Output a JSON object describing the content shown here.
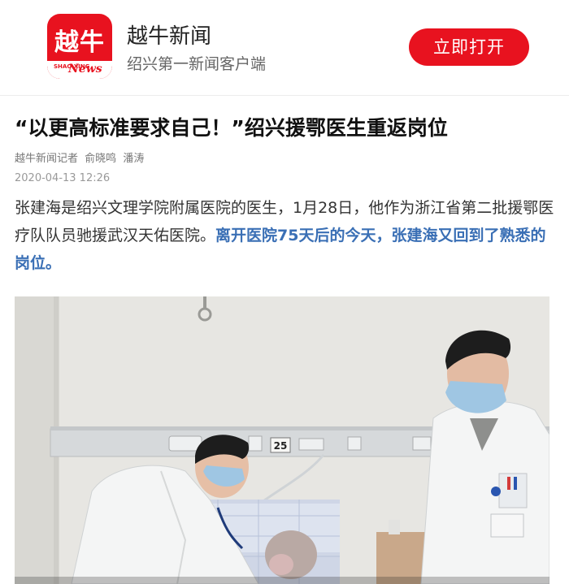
{
  "header": {
    "logo_chars": "越牛",
    "logo_strip_small": "SHAO XING",
    "logo_strip_news": "News",
    "app_name": "越牛新闻",
    "tagline": "绍兴第一新闻客户端",
    "open_button": "立即打开"
  },
  "article": {
    "title": "“以更高标准要求自己！”绍兴援鄂医生重返岗位",
    "reporter_prefix": "越牛新闻记者",
    "reporters": [
      "俞晓鸣",
      "潘涛"
    ],
    "date": "2020-04-13 12:26",
    "body_plain": "张建海是绍兴文理学院附属医院的医生，1月28日，他作为浙江省第二批援鄂医疗队队员驰援武汉天佑医院。",
    "body_highlight": "离开医院75天后的今天，张建海又回到了熟悉的岗位。"
  },
  "photo": {
    "bed_number": "25"
  },
  "colors": {
    "brand_red": "#e8121f",
    "highlight_blue": "#3a6fb5"
  }
}
